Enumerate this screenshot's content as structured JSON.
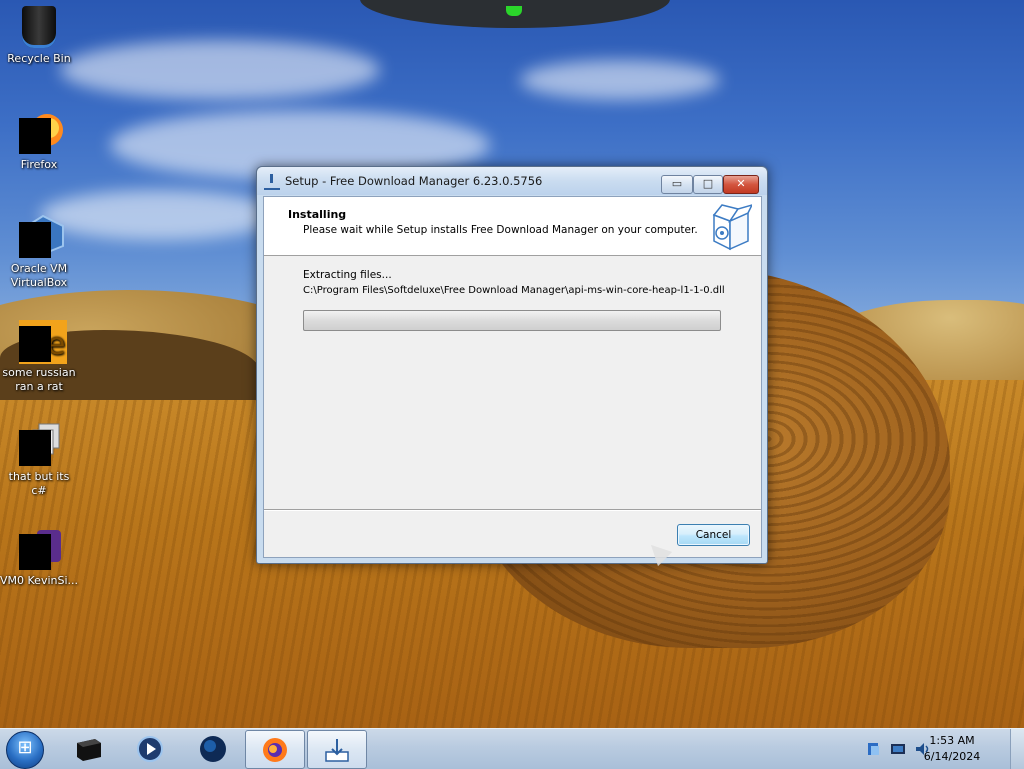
{
  "desktop": {
    "icons": [
      {
        "label": "Recycle Bin",
        "icon": "recycle-bin-icon"
      },
      {
        "label": "Firefox",
        "icon": "firefox-icon"
      },
      {
        "label": "Oracle VM VirtualBox",
        "icon": "virtualbox-icon"
      },
      {
        "label": "some russian ran a rat",
        "icon": "app-icon"
      },
      {
        "label": "that but its c#",
        "icon": "copy-icon"
      },
      {
        "label": "VM0 KevinSi...",
        "icon": "shortcut-icon"
      }
    ]
  },
  "dialog": {
    "title": "Setup - Free Download Manager 6.23.0.5756",
    "header_title": "Installing",
    "header_subtitle": "Please wait while Setup installs Free Download Manager on your computer.",
    "status": "Extracting files...",
    "path": "C:\\Program Files\\Softdeluxe\\Free Download Manager\\api-ms-win-core-heap-l1-1-0.dll",
    "progress": 0.0,
    "cancel_label": "Cancel",
    "minimize_glyph": "▭",
    "maximize_glyph": "□",
    "close_glyph": "✕"
  },
  "taskbar": {
    "pinned": [
      {
        "name": "terminal-icon",
        "active": false
      },
      {
        "name": "media-player-icon",
        "active": false
      },
      {
        "name": "globe-icon",
        "active": false
      },
      {
        "name": "firefox-icon",
        "active": true
      },
      {
        "name": "installer-icon",
        "active": true
      }
    ],
    "tray_icons": [
      "network-icon",
      "display-icon",
      "volume-icon"
    ],
    "time": "1:53 AM",
    "date": "6/14/2024"
  },
  "colors": {
    "progress_green": "#5cc64e",
    "close_red": "#c23a23",
    "accent_blue": "#3c7fb1"
  }
}
